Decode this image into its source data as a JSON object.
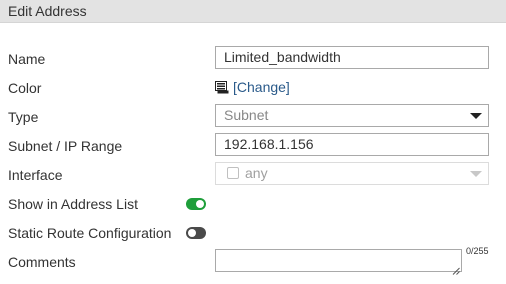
{
  "dialog": {
    "title": "Edit Address"
  },
  "form": {
    "name": {
      "label": "Name",
      "value": "Limited_bandwidth"
    },
    "color": {
      "label": "Color",
      "link": "[Change]",
      "icon": "color-swatch-icon"
    },
    "type": {
      "label": "Type",
      "value": "Subnet",
      "icon": "chevron-down-icon"
    },
    "subnet": {
      "label": "Subnet / IP Range",
      "value": "192.168.1.156"
    },
    "interface": {
      "label": "Interface",
      "value": "any",
      "disabled": true
    },
    "show_in_list": {
      "label": "Show in Address List",
      "enabled": true
    },
    "static_route": {
      "label": "Static Route Configuration",
      "enabled": false
    },
    "comments": {
      "label": "Comments",
      "value": "",
      "counter": "0/255"
    }
  },
  "colors": {
    "toggle_on": "#1e9e3a",
    "toggle_off": "#4a4a4a",
    "link": "#2a5a8a",
    "titlebar": "#e3e3e3"
  }
}
